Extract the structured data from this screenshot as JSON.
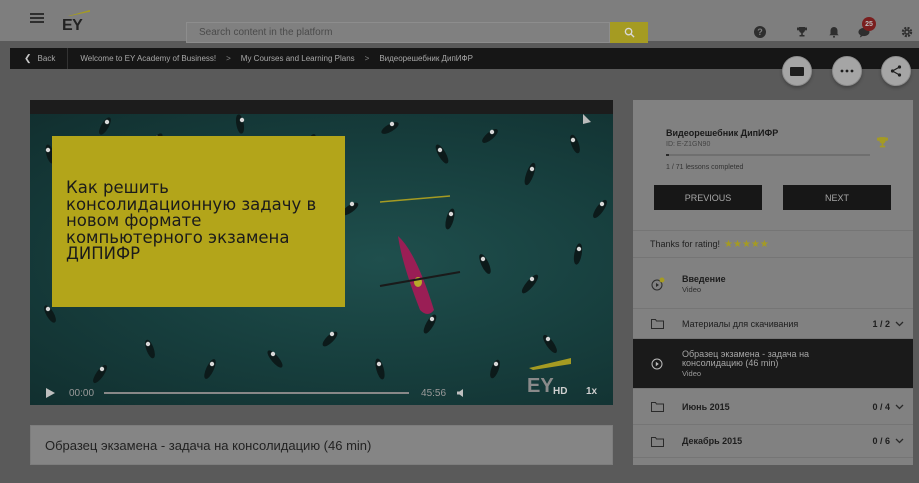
{
  "header": {
    "menu_icon": "hamburger-icon",
    "logo_text": "EY",
    "search_placeholder": "Search content in the platform",
    "search_icon": "search-icon",
    "icons": [
      "help-icon",
      "trophy-icon",
      "bell-icon",
      "chat-icon",
      "gear-icon"
    ],
    "notification_count": "25"
  },
  "breadcrumb": {
    "back_label": "Back",
    "items": [
      "Welcome to EY Academy of Business!",
      "My Courses and Learning Plans",
      "Видеорешебник ДипИФР"
    ],
    "separator": ">"
  },
  "floating_actions": [
    "display-icon",
    "more-icon",
    "share-icon"
  ],
  "video": {
    "slide_text": "Как решить консолидационную задачу в новом формате компьютерного экзамена ДИПИФР",
    "time_current": "00:00",
    "time_total": "45:56",
    "progress": 0,
    "quality": "HD",
    "speed": "1x",
    "watermark": "EY"
  },
  "lesson_title": "Образец экзамена - задача на консолидацию (46 min)",
  "course": {
    "name": "Видеорешебник ДипИФР",
    "id_label": "ID: E-Z1GN90",
    "lessons_completed": "1 / 71 lessons completed",
    "progress_fraction": 0.014,
    "previous_label": "PREVIOUS",
    "next_label": "NEXT",
    "rating_label": "Thanks for rating!",
    "rating_stars": 5
  },
  "sections": [
    {
      "icon": "play-badge-icon",
      "title": "Введение",
      "sub": "Video",
      "count": "",
      "active": false
    },
    {
      "icon": "folder-icon",
      "title": "Материалы для скачивания",
      "sub": "",
      "count": "1 / 2",
      "active": false
    },
    {
      "icon": "play-circle-icon",
      "title": "Образец экзамена - задача на консолидацию (46 min)",
      "sub": "Video",
      "count": "",
      "active": true
    },
    {
      "icon": "folder-icon",
      "title": "Июнь 2015",
      "sub": "",
      "count": "0 / 4",
      "active": false
    },
    {
      "icon": "folder-icon",
      "title": "Декабрь 2015",
      "sub": "",
      "count": "0 / 6",
      "active": false
    }
  ],
  "colors": {
    "accent": "#a59b22",
    "dark_bar": "#161616",
    "overlay_bg": "#5a5a5a",
    "badge": "#7a1e1e"
  }
}
